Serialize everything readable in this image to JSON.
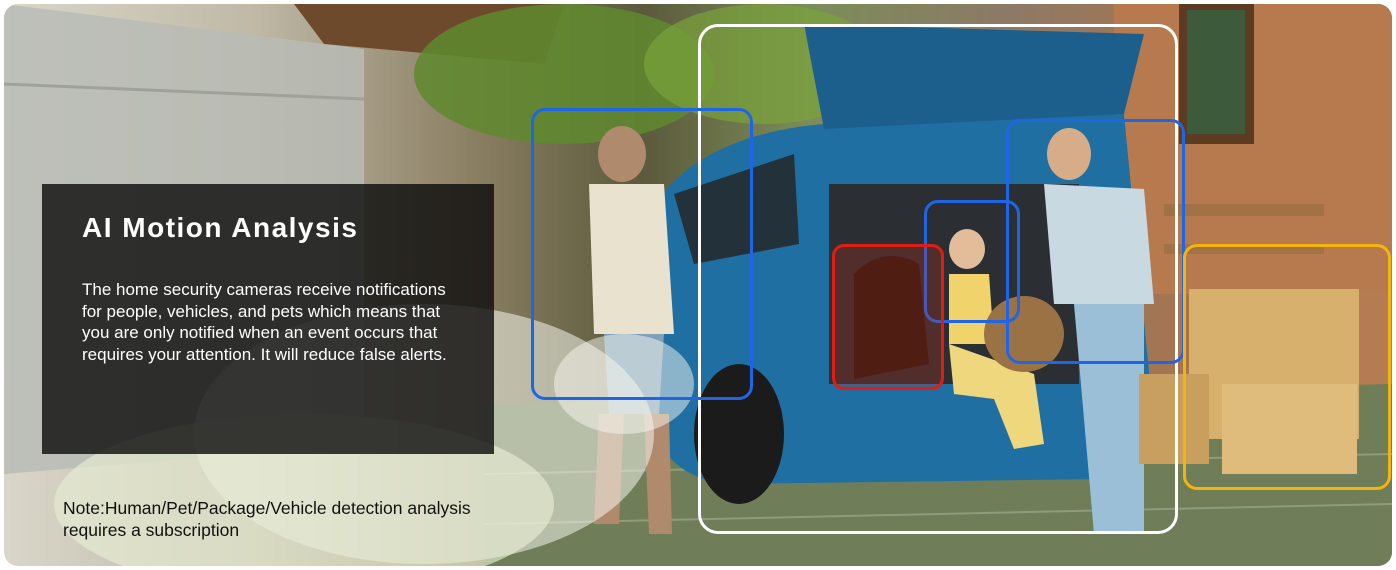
{
  "caption": {
    "title": "AI Motion Analysis",
    "description": "The home security cameras receive notifications for people, vehicles, and pets which means that you are only notified when an event occurs that requires your attention. It will reduce false alerts."
  },
  "note": "Note:Human/Pet/Package/Vehicle detection analysis requires a subscription",
  "colors": {
    "vehicle_box": "#ffffff",
    "human_box": "#1f66e6",
    "pet_box": "#e01d10",
    "package_box": "#f5b40a",
    "caption_bg": "#0a0a0a"
  }
}
